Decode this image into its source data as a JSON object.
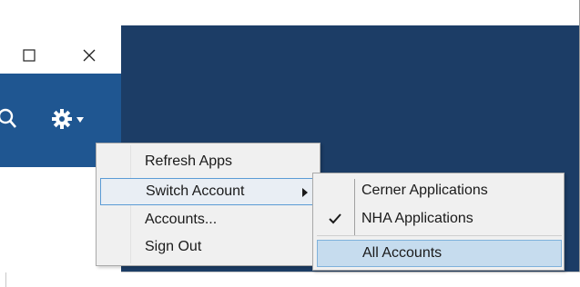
{
  "window_controls": {
    "maximize_icon": "maximize-icon",
    "close_icon": "close-icon"
  },
  "app_bar": {
    "search_icon": "search-icon",
    "settings_icon": "gear-icon",
    "settings_dropdown_icon": "caret-down-icon"
  },
  "context_menu": {
    "items": [
      {
        "label": "Refresh Apps"
      },
      {
        "label": "Switch Account",
        "submenu_arrow": "submenu-arrow-icon"
      },
      {
        "label": "Accounts..."
      },
      {
        "label": "Sign Out"
      }
    ]
  },
  "account_submenu": {
    "items": [
      {
        "label": "Cerner Applications",
        "checked": false
      },
      {
        "label": "NHA Applications",
        "checked": true
      },
      {
        "label": "All Accounts",
        "checked": false
      }
    ]
  },
  "colors": {
    "app_bar": "#1f5691",
    "background": "#1c3d66",
    "menu_bg": "#f0f0f0",
    "highlight_border": "#5b9bd5",
    "submenu_highlight": "#c6dcee"
  }
}
